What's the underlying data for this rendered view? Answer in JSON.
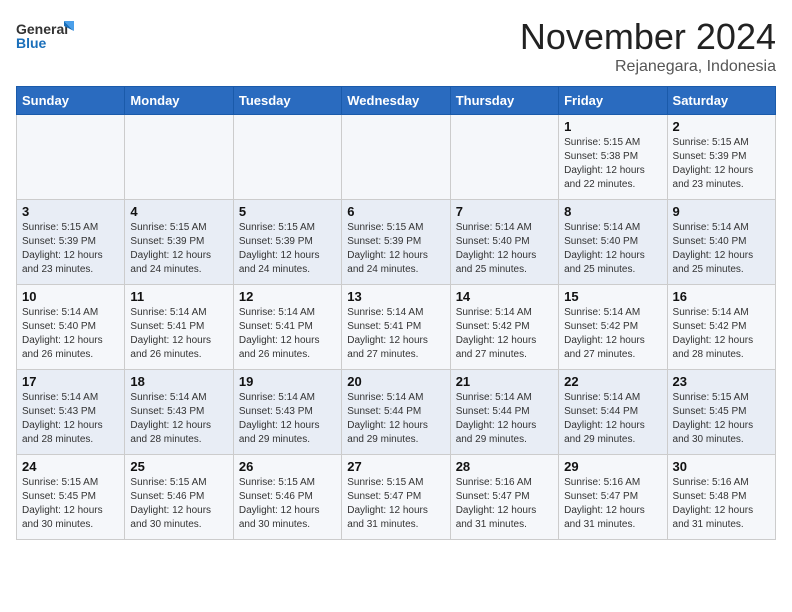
{
  "logo": {
    "general": "General",
    "blue": "Blue"
  },
  "title": "November 2024",
  "subtitle": "Rejanegara, Indonesia",
  "days_of_week": [
    "Sunday",
    "Monday",
    "Tuesday",
    "Wednesday",
    "Thursday",
    "Friday",
    "Saturday"
  ],
  "weeks": [
    [
      {
        "day": "",
        "content": ""
      },
      {
        "day": "",
        "content": ""
      },
      {
        "day": "",
        "content": ""
      },
      {
        "day": "",
        "content": ""
      },
      {
        "day": "",
        "content": ""
      },
      {
        "day": "1",
        "content": "Sunrise: 5:15 AM\nSunset: 5:38 PM\nDaylight: 12 hours\nand 22 minutes."
      },
      {
        "day": "2",
        "content": "Sunrise: 5:15 AM\nSunset: 5:39 PM\nDaylight: 12 hours\nand 23 minutes."
      }
    ],
    [
      {
        "day": "3",
        "content": "Sunrise: 5:15 AM\nSunset: 5:39 PM\nDaylight: 12 hours\nand 23 minutes."
      },
      {
        "day": "4",
        "content": "Sunrise: 5:15 AM\nSunset: 5:39 PM\nDaylight: 12 hours\nand 24 minutes."
      },
      {
        "day": "5",
        "content": "Sunrise: 5:15 AM\nSunset: 5:39 PM\nDaylight: 12 hours\nand 24 minutes."
      },
      {
        "day": "6",
        "content": "Sunrise: 5:15 AM\nSunset: 5:39 PM\nDaylight: 12 hours\nand 24 minutes."
      },
      {
        "day": "7",
        "content": "Sunrise: 5:14 AM\nSunset: 5:40 PM\nDaylight: 12 hours\nand 25 minutes."
      },
      {
        "day": "8",
        "content": "Sunrise: 5:14 AM\nSunset: 5:40 PM\nDaylight: 12 hours\nand 25 minutes."
      },
      {
        "day": "9",
        "content": "Sunrise: 5:14 AM\nSunset: 5:40 PM\nDaylight: 12 hours\nand 25 minutes."
      }
    ],
    [
      {
        "day": "10",
        "content": "Sunrise: 5:14 AM\nSunset: 5:40 PM\nDaylight: 12 hours\nand 26 minutes."
      },
      {
        "day": "11",
        "content": "Sunrise: 5:14 AM\nSunset: 5:41 PM\nDaylight: 12 hours\nand 26 minutes."
      },
      {
        "day": "12",
        "content": "Sunrise: 5:14 AM\nSunset: 5:41 PM\nDaylight: 12 hours\nand 26 minutes."
      },
      {
        "day": "13",
        "content": "Sunrise: 5:14 AM\nSunset: 5:41 PM\nDaylight: 12 hours\nand 27 minutes."
      },
      {
        "day": "14",
        "content": "Sunrise: 5:14 AM\nSunset: 5:42 PM\nDaylight: 12 hours\nand 27 minutes."
      },
      {
        "day": "15",
        "content": "Sunrise: 5:14 AM\nSunset: 5:42 PM\nDaylight: 12 hours\nand 27 minutes."
      },
      {
        "day": "16",
        "content": "Sunrise: 5:14 AM\nSunset: 5:42 PM\nDaylight: 12 hours\nand 28 minutes."
      }
    ],
    [
      {
        "day": "17",
        "content": "Sunrise: 5:14 AM\nSunset: 5:43 PM\nDaylight: 12 hours\nand 28 minutes."
      },
      {
        "day": "18",
        "content": "Sunrise: 5:14 AM\nSunset: 5:43 PM\nDaylight: 12 hours\nand 28 minutes."
      },
      {
        "day": "19",
        "content": "Sunrise: 5:14 AM\nSunset: 5:43 PM\nDaylight: 12 hours\nand 29 minutes."
      },
      {
        "day": "20",
        "content": "Sunrise: 5:14 AM\nSunset: 5:44 PM\nDaylight: 12 hours\nand 29 minutes."
      },
      {
        "day": "21",
        "content": "Sunrise: 5:14 AM\nSunset: 5:44 PM\nDaylight: 12 hours\nand 29 minutes."
      },
      {
        "day": "22",
        "content": "Sunrise: 5:14 AM\nSunset: 5:44 PM\nDaylight: 12 hours\nand 29 minutes."
      },
      {
        "day": "23",
        "content": "Sunrise: 5:15 AM\nSunset: 5:45 PM\nDaylight: 12 hours\nand 30 minutes."
      }
    ],
    [
      {
        "day": "24",
        "content": "Sunrise: 5:15 AM\nSunset: 5:45 PM\nDaylight: 12 hours\nand 30 minutes."
      },
      {
        "day": "25",
        "content": "Sunrise: 5:15 AM\nSunset: 5:46 PM\nDaylight: 12 hours\nand 30 minutes."
      },
      {
        "day": "26",
        "content": "Sunrise: 5:15 AM\nSunset: 5:46 PM\nDaylight: 12 hours\nand 30 minutes."
      },
      {
        "day": "27",
        "content": "Sunrise: 5:15 AM\nSunset: 5:47 PM\nDaylight: 12 hours\nand 31 minutes."
      },
      {
        "day": "28",
        "content": "Sunrise: 5:16 AM\nSunset: 5:47 PM\nDaylight: 12 hours\nand 31 minutes."
      },
      {
        "day": "29",
        "content": "Sunrise: 5:16 AM\nSunset: 5:47 PM\nDaylight: 12 hours\nand 31 minutes."
      },
      {
        "day": "30",
        "content": "Sunrise: 5:16 AM\nSunset: 5:48 PM\nDaylight: 12 hours\nand 31 minutes."
      }
    ]
  ]
}
